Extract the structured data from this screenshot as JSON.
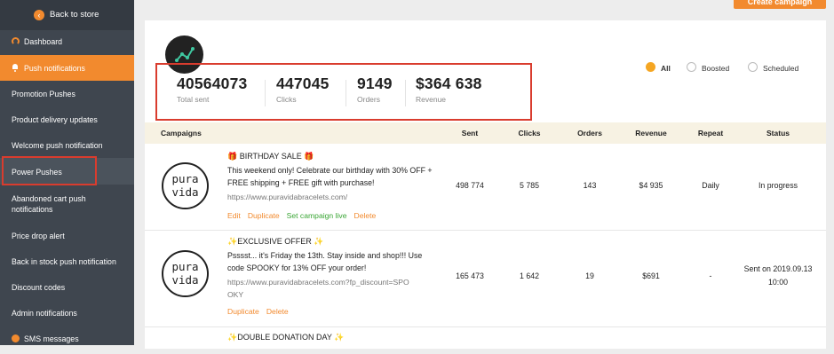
{
  "sidebar": {
    "back_label": "Back to store",
    "items": [
      {
        "label": "Dashboard",
        "icon": "gauge-icon"
      },
      {
        "label": "Push notifications",
        "icon": "bell-icon"
      },
      {
        "label": "Promotion Pushes"
      },
      {
        "label": "Product delivery updates"
      },
      {
        "label": "Welcome push notification"
      },
      {
        "label": "Power Pushes"
      },
      {
        "label": "Abandoned cart push notifications"
      },
      {
        "label": "Price drop alert"
      },
      {
        "label": "Back in stock push notification"
      },
      {
        "label": "Discount codes"
      },
      {
        "label": "Admin notifications"
      },
      {
        "label": "SMS messages",
        "icon": "sms-icon"
      }
    ]
  },
  "header": {
    "create_label": "Create campaign"
  },
  "stats": [
    {
      "value": "40564073",
      "label": "Total sent"
    },
    {
      "value": "447045",
      "label": "Clicks"
    },
    {
      "value": "9149",
      "label": "Orders"
    },
    {
      "value": "$364 638",
      "label": "Revenue"
    }
  ],
  "filters": [
    {
      "label": "All",
      "selected": true
    },
    {
      "label": "Boosted",
      "selected": false
    },
    {
      "label": "Scheduled",
      "selected": false
    }
  ],
  "table": {
    "headers": [
      "Campaigns",
      "Sent",
      "Clicks",
      "Orders",
      "Revenue",
      "Repeat",
      "Status"
    ],
    "rows": [
      {
        "logo_top": "pura",
        "logo_bottom": "vida",
        "title": "🎁 BIRTHDAY SALE 🎁",
        "desc": "This weekend only! Celebrate our birthday with 30% OFF + FREE shipping + FREE gift with purchase!",
        "url": "https://www.puravidabracelets.com/",
        "actions": [
          "Edit",
          "Duplicate",
          "Set campaign live",
          "Delete"
        ],
        "sent": "498 774",
        "clicks": "5 785",
        "orders": "143",
        "revenue": "$4 935",
        "repeat": "Daily",
        "status": "In progress"
      },
      {
        "logo_top": "pura",
        "logo_bottom": "vida",
        "title": "✨EXCLUSIVE OFFER ✨",
        "desc": "Psssst... it's Friday the 13th. Stay inside and shop!!! Use code SPOOKY for 13% OFF your order!",
        "url": "https://www.puravidabracelets.com?fp_discount=SPOOKY",
        "actions": [
          "Duplicate",
          "Delete"
        ],
        "sent": "165 473",
        "clicks": "1 642",
        "orders": "19",
        "revenue": "$691",
        "repeat": "-",
        "status": "Sent on 2019.09.13 10:00"
      },
      {
        "title": "✨DOUBLE DONATION DAY ✨"
      }
    ]
  },
  "colors": {
    "accent": "#f28a2e",
    "sidebar": "#3f464f",
    "highlight_box": "#d93c2e",
    "live_green": "#3aa635"
  }
}
